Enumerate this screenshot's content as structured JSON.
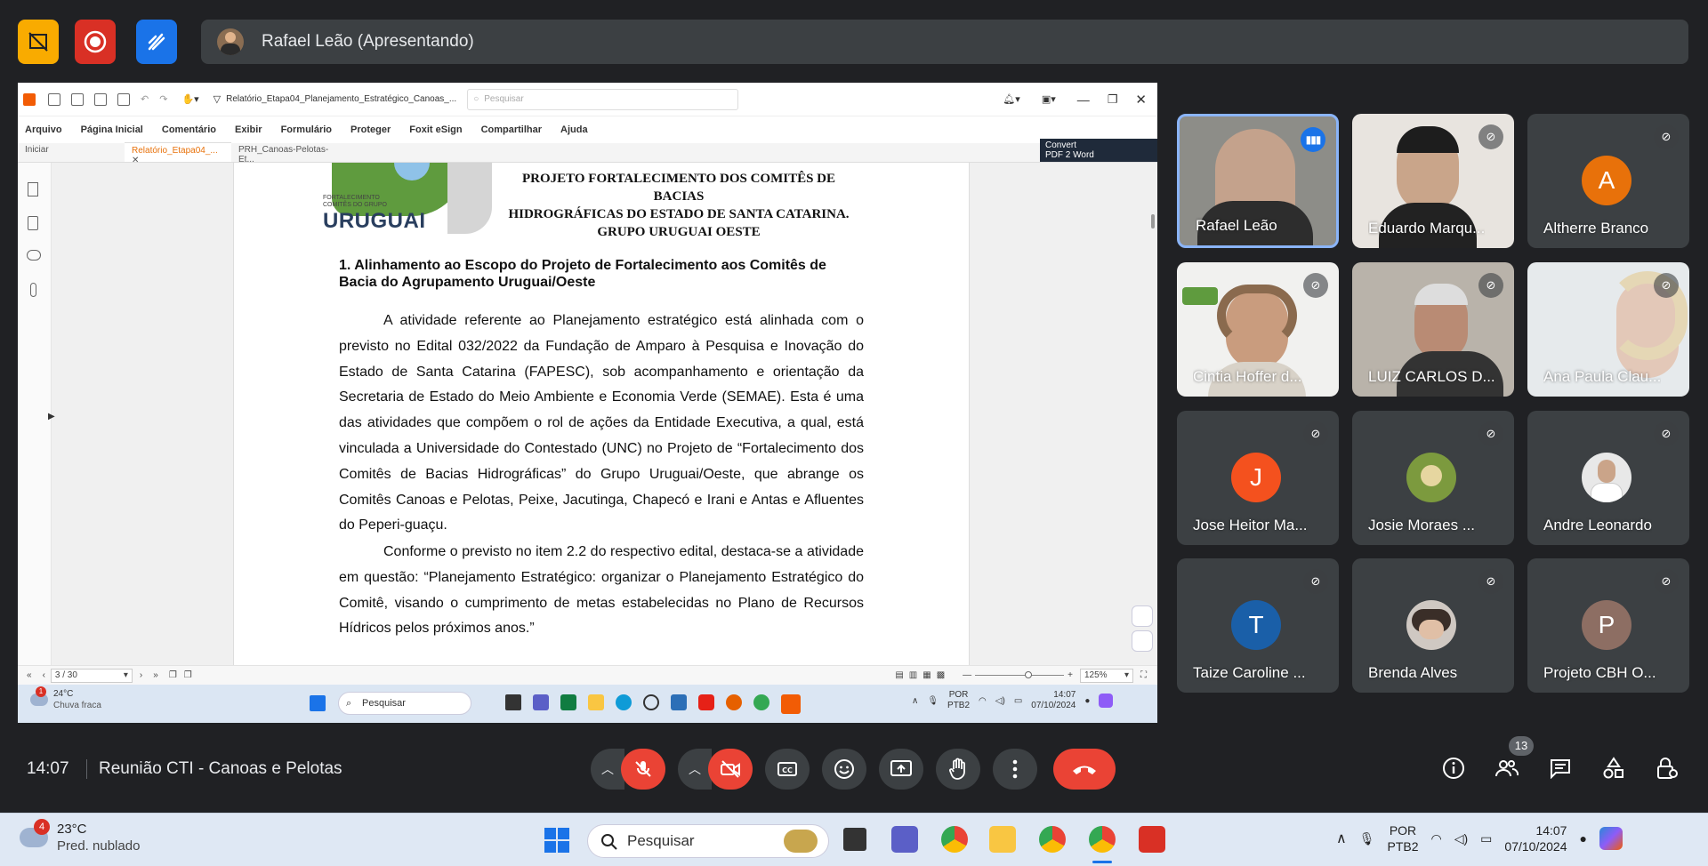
{
  "presenter": {
    "name": "Rafael Leão (Apresentando)"
  },
  "foxit": {
    "filename": "Relatório_Etapa04_Planejamento_Estratégico_Canoas_...",
    "search_placeholder": "Pesquisar",
    "menu": [
      "Arquivo",
      "Página Inicial",
      "Comentário",
      "Exibir",
      "Formulário",
      "Proteger",
      "Foxit eSign",
      "Compartilhar",
      "Ajuda"
    ],
    "tabs": [
      "Iniciar",
      "Relatório_Etapa04_...",
      "PRH_Canoas-Pelotas-Et..."
    ],
    "convert_label": "Convert",
    "convert_sub": "PDF 2 Word",
    "page_indicator": "3 / 30",
    "zoom": "125%"
  },
  "document": {
    "header": [
      "PROJETO FORTALECIMENTO DOS COMITÊS DE BACIAS",
      "HIDROGRÁFICAS DO ESTADO DE SANTA CATARINA.",
      "GRUPO URUGUAI OESTE"
    ],
    "logo_small": "FORTALECIMENTO COMITÊS DO GRUPO",
    "logo_big": "URUGUAI",
    "section_title": "1.  Alinhamento ao Escopo do Projeto de Fortalecimento aos Comitês de Bacia do Agrupamento Uruguai/Oeste",
    "paragraph1": "A atividade referente ao Planejamento estratégico está alinhada com o previsto no Edital 032/2022 da Fundação de Amparo à Pesquisa e Inovação do Estado de Santa Catarina (FAPESC), sob acompanhamento e orientação da Secretaria de Estado do Meio Ambiente e Economia Verde (SEMAE). Esta é uma das atividades que compõem o rol de ações da Entidade Executiva, a qual, está vinculada a Universidade do Contestado (UNC) no Projeto de “Fortalecimento dos Comitês de Bacias Hidrográficas” do Grupo Uruguai/Oeste, que abrange os Comitês Canoas e Pelotas, Peixe, Jacutinga, Chapecó e Irani e Antas e Afluentes do Peperi-guaçu.",
    "paragraph2": "Conforme o previsto no item 2.2 do respectivo edital, destaca-se a atividade em questão: “Planejamento Estratégico: organizar o Planejamento Estratégico do Comitê, visando o cumprimento de metas estabelecidas no Plano de Recursos Hídricos pelos próximos anos.”"
  },
  "inner_taskbar": {
    "weather_temp": "24°C",
    "weather_desc": "Chuva fraca",
    "weather_badge": "1",
    "search": "Pesquisar",
    "lang1": "POR",
    "lang2": "PTB2",
    "time": "14:07",
    "date": "07/10/2024"
  },
  "participants": [
    {
      "name": "Rafael Leão",
      "type": "video"
    },
    {
      "name": "Eduardo Marqu...",
      "type": "video"
    },
    {
      "name": "Altherre Branco",
      "type": "initial",
      "initial": "A",
      "color": "#e8710a"
    },
    {
      "name": "Cintia Hoffer d...",
      "type": "video"
    },
    {
      "name": "LUIZ CARLOS D...",
      "type": "video"
    },
    {
      "name": "Ana Paula Clau...",
      "type": "video"
    },
    {
      "name": "Jose Heitor Ma...",
      "type": "initial",
      "initial": "J",
      "color": "#f4511e"
    },
    {
      "name": "Josie Moraes ...",
      "type": "photo"
    },
    {
      "name": "Andre Leonardo",
      "type": "photo"
    },
    {
      "name": "Taize Caroline ...",
      "type": "initial",
      "initial": "T",
      "color": "#1a5fa8"
    },
    {
      "name": "Brenda Alves",
      "type": "photo"
    },
    {
      "name": "Projeto CBH O...",
      "type": "initial",
      "initial": "P",
      "color": "#8d6e63"
    }
  ],
  "meeting": {
    "time": "14:07",
    "title": "Reunião CTI - Canoas e Pelotas",
    "people_count": "13"
  },
  "taskbar": {
    "weather_temp": "23°C",
    "weather_desc": "Pred. nublado",
    "weather_badge": "4",
    "search": "Pesquisar",
    "lang1": "POR",
    "lang2": "PTB2",
    "time": "14:07",
    "date": "07/10/2024"
  },
  "colors": {
    "accent_blue": "#8ab4f8",
    "end_call": "#ea4335",
    "bg": "#202124",
    "tile": "#3c4043"
  }
}
